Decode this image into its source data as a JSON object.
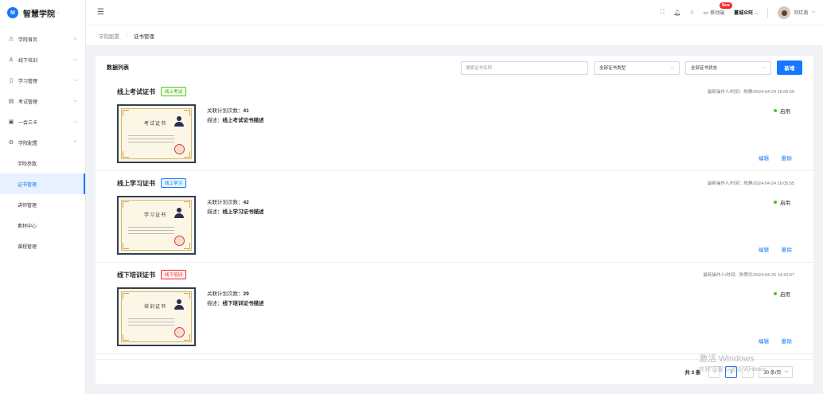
{
  "app": {
    "logo_mark": "M",
    "name": "智慧学院",
    "caret": "⌵"
  },
  "sidebar": {
    "items": [
      {
        "label": "学院首页",
        "icon": "⚠"
      },
      {
        "label": "线下培训",
        "icon": "♙"
      },
      {
        "label": "学习管理",
        "icon": "▯"
      },
      {
        "label": "考试管理",
        "icon": "▤"
      },
      {
        "label": "一会三卡",
        "icon": "▣"
      },
      {
        "label": "学院配置",
        "icon": "⚙"
      }
    ],
    "subitems": [
      {
        "label": "学院参数"
      },
      {
        "label": "证书管理"
      },
      {
        "label": "讲师管理"
      },
      {
        "label": "素材中心"
      },
      {
        "label": "课程管理"
      }
    ]
  },
  "topbar": {
    "mobile_label": "移动端",
    "new_badge": "New",
    "org_name": "蔓城众旺",
    "org_caret": "⌵",
    "user_name": "邓红南",
    "user_caret": "⌵"
  },
  "breadcrumb": {
    "parent": "学院配置",
    "separator": "/",
    "current": "证书管理"
  },
  "list": {
    "title": "数据列表",
    "search_placeholder": "搜索证书名称",
    "type_filter": "全部证书类型",
    "status_filter": "全部证书状态",
    "new_button": "新增"
  },
  "certificates": [
    {
      "name": "线上考试证书",
      "tag": "线上考试",
      "thumb_title": "考试证书",
      "op": "最新操作人/时间：陈静/2024-04-24 16:05:59",
      "count_label": "关联计划次数：",
      "count": "41",
      "desc_label": "描述：",
      "desc": "线上考试证书描述",
      "status": "启用",
      "edit": "编辑",
      "delete": "删除"
    },
    {
      "name": "线上学习证书",
      "tag": "线上学习",
      "thumb_title": "学习证书",
      "op": "最新操作人/时间：陈静/2024-04-24 16:05:55",
      "count_label": "关联计划次数：",
      "count": "42",
      "desc_label": "描述：",
      "desc": "线上学习证书描述",
      "status": "启用",
      "edit": "编辑",
      "delete": "删除"
    },
    {
      "name": "线下培训证书",
      "tag": "线下培训",
      "thumb_title": "培训证书",
      "op": "最新操作人/时间：陈秀玲/2024-04-25 14:20:57",
      "count_label": "关联计划次数：",
      "count": "29",
      "desc_label": "描述：",
      "desc": "线下培训证书描述",
      "status": "启用",
      "edit": "编辑",
      "delete": "删除"
    }
  ],
  "pager": {
    "total": "共 3 条",
    "prev": "‹",
    "page": "1",
    "next": "›",
    "size": "30 条/页",
    "size_caret": "⌵"
  },
  "watermark": {
    "line1": "激活 Windows",
    "line2": "转到\"设置\"以激活 Windows。"
  },
  "colors": {
    "primary": "#1677ff",
    "green": "#52c41a",
    "red": "#f5222d"
  }
}
